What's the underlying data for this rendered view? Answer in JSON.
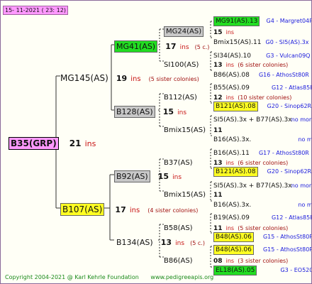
{
  "header": {
    "date": "15- 11-2021 ( 23: 12)"
  },
  "root": {
    "name": "B35(GRP)",
    "count": "21",
    "ins": "ins"
  },
  "gen1": [
    {
      "name": "MG145(AS)",
      "count": "19",
      "ins": "ins",
      "note": "(5 sister colonies)"
    },
    {
      "name": "B107(AS)",
      "count": "17",
      "ins": "ins",
      "note": "(4 sister colonies)"
    }
  ],
  "gen2": [
    {
      "name": "MG41(AS)",
      "count": "17",
      "ins": "ins",
      "note": "(5 c.)"
    },
    {
      "name": "B128(AS)",
      "count": "15",
      "ins": "ins",
      "note": ""
    },
    {
      "name": "B92(AS)",
      "count": "15",
      "ins": "ins",
      "note": ""
    },
    {
      "name": "B134(AS)",
      "count": "13",
      "ins": "ins",
      "note": "(5 c.)"
    }
  ],
  "gen3": [
    {
      "name": "MG24(AS)",
      "count": "15",
      "ins": "ins",
      "note": ""
    },
    {
      "name": "SI100(AS)",
      "count": "13",
      "ins": "ins",
      "note": "(6 sister colonies)"
    },
    {
      "name": "B112(AS)",
      "count": "12",
      "ins": "ins",
      "note": "(10 sister colonies)"
    },
    {
      "name": "Bmix15(AS)",
      "count": "11",
      "ins": "",
      "note": ""
    },
    {
      "name": "B37(AS)",
      "count": "13",
      "ins": "ins",
      "note": "(6 sister colonies)"
    },
    {
      "name": "Bmix15(AS)",
      "count": "11",
      "ins": "",
      "note": ""
    },
    {
      "name": "B58(AS)",
      "count": "11",
      "ins": "ins",
      "note": "(5 sister colonies)"
    },
    {
      "name": "B86(AS)",
      "count": "08",
      "ins": "ins",
      "note": "(3 sister colonies)"
    }
  ],
  "gen4": [
    {
      "name": "MG91(AS).13",
      "ref": "G4 - Margret04R"
    },
    {
      "name": "Bmix15(AS).11",
      "ref": "G0 - SI5(AS).3x"
    },
    {
      "name": "SI34(AS).10",
      "ref": "G3 - Vulcan09Q"
    },
    {
      "name": "B86(AS).08",
      "ref": "G16 - AthosSt80R"
    },
    {
      "name": "B55(AS).09",
      "ref": "G12 - Atlas85R"
    },
    {
      "name": "B121(AS).08",
      "ref": "G20 - Sinop62R"
    },
    {
      "name": "SI5(AS).3x + B77(AS).3x",
      "ref": "no more"
    },
    {
      "name": "B16(AS).3x.",
      "ref": "no more"
    },
    {
      "name": "B16(AS).11",
      "ref": "G17 - AthosSt80R"
    },
    {
      "name": "B121(AS).08",
      "ref": "G20 - Sinop62R"
    },
    {
      "name": "SI5(AS).3x + B77(AS).3x",
      "ref": "no more"
    },
    {
      "name": "B16(AS).3x.",
      "ref": "no more"
    },
    {
      "name": "B19(AS).09",
      "ref": "G12 - Atlas85R"
    },
    {
      "name": "B48(AS).06",
      "ref": "G15 - AthosSt80R"
    },
    {
      "name": "B48(AS).06",
      "ref": "G15 - AthosSt80R"
    },
    {
      "name": "EL18(AS).05",
      "ref": "G3 - EO520"
    }
  ],
  "footer": {
    "copyright": "Copyright 2004-2021 @ Karl Kehrle Foundation",
    "site": "www.pedigreeapis.org"
  },
  "colors": {
    "line": "#333333",
    "ins": "#c81414",
    "ref": "#1a1adc",
    "green": "#22dd22",
    "yellow": "#ffff22",
    "gray": "#c8c8c8",
    "pink": "#ff99ff"
  }
}
